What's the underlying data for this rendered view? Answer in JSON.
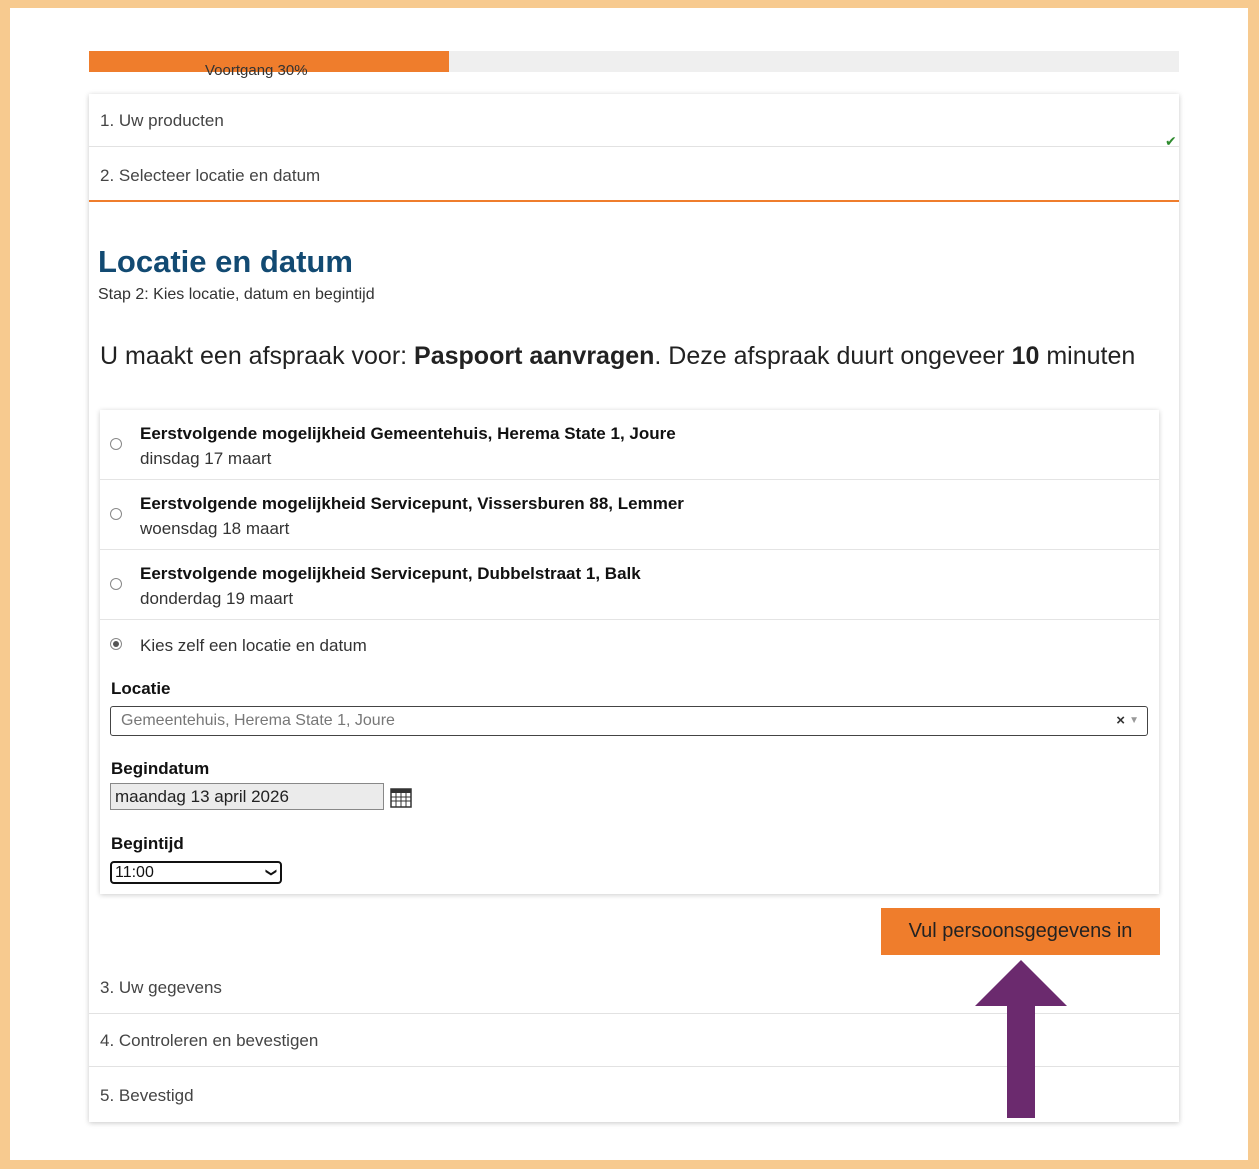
{
  "progress": {
    "label": "Voortgang 30%",
    "percent": 33
  },
  "steps": [
    {
      "label": "1. Uw producten",
      "completed": true
    },
    {
      "label": "2. Selecteer locatie en datum",
      "active": true
    },
    {
      "label": "3. Uw gegevens"
    },
    {
      "label": "4. Controleren en bevestigen"
    },
    {
      "label": "5. Bevestigd"
    }
  ],
  "section": {
    "title": "Locatie en datum",
    "subtitle": "Stap 2: Kies locatie, datum en begintijd"
  },
  "intro": {
    "prefix": "U maakt een afspraak voor: ",
    "product": "Paspoort aanvragen",
    "middle": ". Deze afspraak duurt ongeveer ",
    "duration": "10",
    "suffix": " minuten"
  },
  "options": [
    {
      "title": "Eerstvolgende mogelijkheid Gemeentehuis, Herema State 1, Joure",
      "date": "dinsdag 17 maart",
      "checked": false
    },
    {
      "title": "Eerstvolgende mogelijkheid Servicepunt, Vissersburen 88, Lemmer",
      "date": "woensdag 18 maart",
      "checked": false
    },
    {
      "title": "Eerstvolgende mogelijkheid Servicepunt, Dubbelstraat 1, Balk",
      "date": "donderdag 19 maart",
      "checked": false
    }
  ],
  "own_choice": {
    "label": "Kies zelf een locatie en datum",
    "checked": true,
    "location_label": "Locatie",
    "location_value": "Gemeentehuis, Herema State 1, Joure",
    "clear_symbol": "×",
    "date_label": "Begindatum",
    "date_value": "maandag 13 april 2026",
    "time_label": "Begintijd",
    "time_value": "11:00"
  },
  "next_button": "Vul persoonsgegevens in",
  "colors": {
    "accent": "#ef7d2c",
    "title": "#124a72",
    "arrow": "#6b2a6e",
    "background": "#f7ca8f"
  }
}
